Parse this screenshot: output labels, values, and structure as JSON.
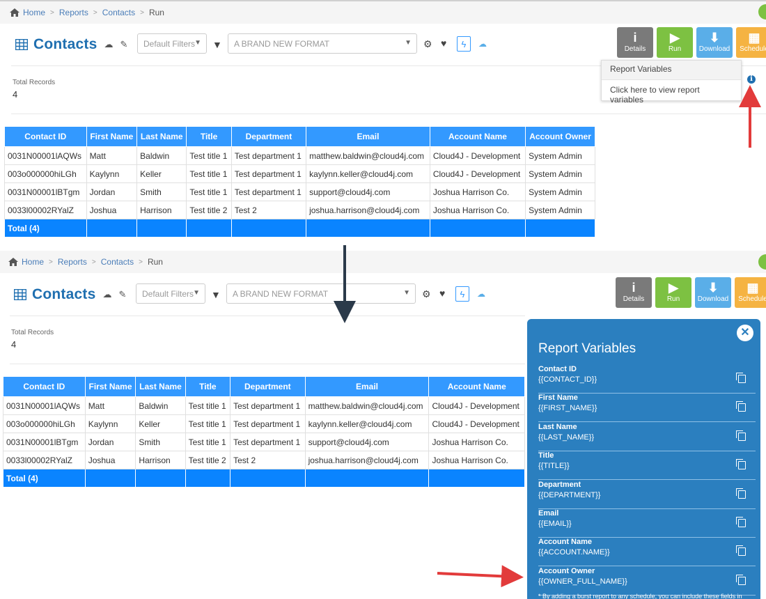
{
  "breadcrumb": {
    "home": "Home",
    "reports": "Reports",
    "contacts": "Contacts",
    "current": "Run"
  },
  "header": {
    "title": "Contacts",
    "filter_select": "Default Filters",
    "format_select": "A BRAND NEW FORMAT"
  },
  "actions": {
    "details": "Details",
    "run": "Run",
    "download": "Download",
    "schedule": "Schedule"
  },
  "summary": {
    "label": "Total Records",
    "value": "4"
  },
  "table": {
    "columns": [
      "Contact ID",
      "First Name",
      "Last Name",
      "Title",
      "Department",
      "Email",
      "Account Name",
      "Account Owner"
    ],
    "rows_top": [
      [
        "0031N00001lAQWs",
        "Matt",
        "Baldwin",
        "Test title 1",
        "Test department 1",
        "matthew.baldwin@cloud4j.com",
        "Cloud4J - Development",
        "System Admin"
      ],
      [
        "003o000000hiLGh",
        "Kaylynn",
        "Keller",
        "Test title 1",
        "Test department 1",
        "kaylynn.keller@cloud4j.com",
        "Cloud4J - Development",
        "System Admin"
      ],
      [
        "0031N00001lBTgm",
        "Jordan",
        "Smith",
        "Test title 1",
        "Test department 1",
        "support@cloud4j.com",
        "Joshua Harrison Co.",
        "System Admin"
      ],
      [
        "0033l00002RYalZ",
        "Joshua",
        "Harrison",
        "Test title 2",
        "Test 2",
        "joshua.harrison@cloud4j.com",
        "Joshua Harrison Co.",
        "System Admin"
      ]
    ],
    "rows_bottom": [
      [
        "0031N00001lAQWs",
        "Matt",
        "Baldwin",
        "Test title 1",
        "Test department 1",
        "matthew.baldwin@cloud4j.com",
        "Cloud4J - Development"
      ],
      [
        "003o000000hiLGh",
        "Kaylynn",
        "Keller",
        "Test title 1",
        "Test department 1",
        "kaylynn.keller@cloud4j.com",
        "Cloud4J - Development"
      ],
      [
        "0031N00001lBTgm",
        "Jordan",
        "Smith",
        "Test title 1",
        "Test department 1",
        "support@cloud4j.com",
        "Joshua Harrison Co."
      ],
      [
        "0033l00002RYalZ",
        "Joshua",
        "Harrison",
        "Test title 2",
        "Test 2",
        "joshua.harrison@cloud4j.com",
        "Joshua Harrison Co."
      ]
    ],
    "total_label": "Total (4)"
  },
  "popover": {
    "title": "Report Variables",
    "body": "Click here to view report variables"
  },
  "variables_panel": {
    "title": "Report Variables",
    "items": [
      {
        "label": "Contact ID",
        "var": "{{CONTACT_ID}}"
      },
      {
        "label": "First Name",
        "var": "{{FIRST_NAME}}"
      },
      {
        "label": "Last Name",
        "var": "{{LAST_NAME}}"
      },
      {
        "label": "Title",
        "var": "{{TITLE}}"
      },
      {
        "label": "Department",
        "var": "{{DEPARTMENT}}"
      },
      {
        "label": "Email",
        "var": "{{EMAIL}}"
      },
      {
        "label": "Account Name",
        "var": "{{ACCOUNT.NAME}}"
      },
      {
        "label": "Account Owner",
        "var": "{{OWNER_FULL_NAME}}"
      }
    ],
    "footnote": "* By adding a burst report to any schedule, you can include these fields in"
  },
  "colors": {
    "accent": "#3399ff",
    "title_blue": "#1f6fb0",
    "panel_blue": "#2b7fbf",
    "arrow_red": "#e23b3b",
    "arrow_dark": "#2b3a4a"
  },
  "icons": [
    "home-icon",
    "grid-icon",
    "cloud-download-icon",
    "edit-icon",
    "filter-icon",
    "gear-icon",
    "heart-icon",
    "bolt-icon",
    "cloud-icon",
    "info-icon",
    "close-icon",
    "copy-icon"
  ]
}
